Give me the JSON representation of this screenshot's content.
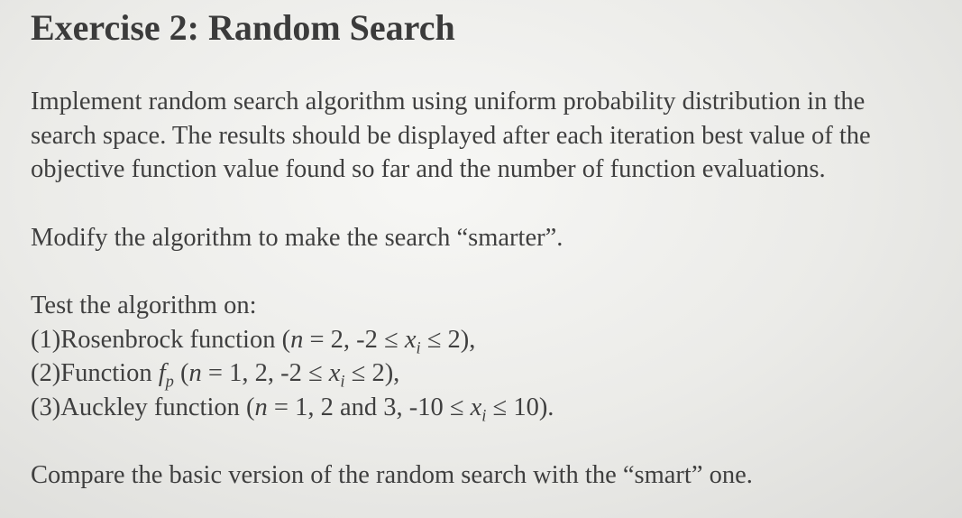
{
  "slide": {
    "title": "Exercise 2: Random Search",
    "intro": [
      "Implement random search algorithm using uniform probability distribution in the",
      "search space. The results should be displayed after each iteration best value of the",
      "objective function value found so far and the number of function evaluations."
    ],
    "modify": "Modify the algorithm to make the search “smarter”.",
    "test_heading": "Test the algorithm on:",
    "tests": [
      {
        "label": "(1)Rosenbrock function (",
        "var_n": "n",
        "range": " = 2, -2 ≤ ",
        "var_x": "x",
        "sub_i": "i",
        "end": " ≤ 2),"
      },
      {
        "label": "(2)Function ",
        "fname": "f",
        "fsub": "p",
        "open": " (",
        "var_n": "n",
        "range": " = 1, 2, -2 ≤ ",
        "var_x": "x",
        "sub_i": "i",
        "end": " ≤ 2),"
      },
      {
        "label": "(3)Auckley function (",
        "var_n": "n",
        "range": " = 1, 2 and 3, -10 ≤ ",
        "var_x": "x",
        "sub_i": "i",
        "end": " ≤ 10)."
      }
    ],
    "compare": "Compare the basic version of the random search with the “smart” one."
  }
}
